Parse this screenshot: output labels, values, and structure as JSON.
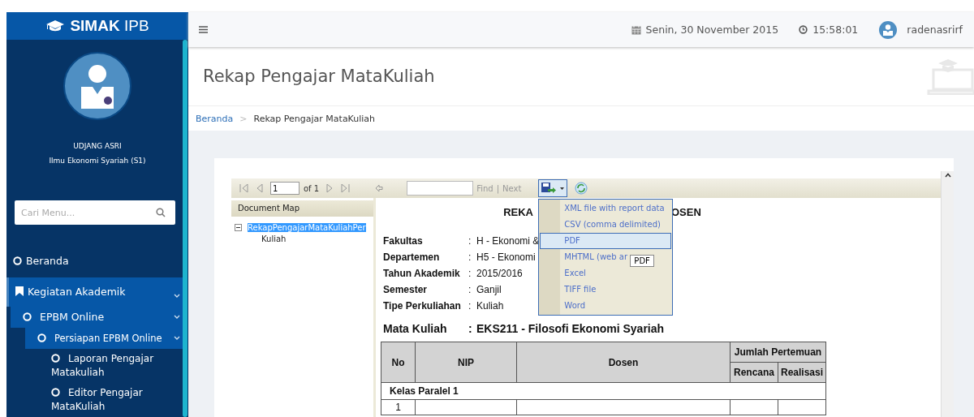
{
  "brand": {
    "bold": "SIMAK",
    "light": "IPB"
  },
  "topbar": {
    "date": "Senin, 30 November 2015",
    "time": "15:58:01",
    "username": "radenasrirf"
  },
  "profile": {
    "name": "UDJANG ASRI",
    "program": "Ilmu Ekonomi Syariah (S1)"
  },
  "search": {
    "placeholder": "Cari Menu..."
  },
  "menu": [
    {
      "label": "Beranda",
      "kind": "circle",
      "selected": false
    },
    {
      "label": "Kegiatan Akademik",
      "kind": "bookmark",
      "selected": true,
      "expanded": true,
      "children": [
        {
          "label": "EPBM Online",
          "kind": "circle",
          "selected": true,
          "expanded": true,
          "children": [
            {
              "label": "Persiapan EPBM Online",
              "kind": "circle",
              "selected": true,
              "expanded": true,
              "children": [
                {
                  "label": "Laporan Pengajar Matakuliah",
                  "kind": "circle",
                  "selected": false
                },
                {
                  "label": "Editor Pengajar MataKuliah",
                  "kind": "circle",
                  "selected": false
                }
              ]
            }
          ]
        }
      ]
    }
  ],
  "page_title": "Rekap Pengajar MataKuliah",
  "breadcrumb": {
    "separator": ">",
    "items": [
      {
        "label": "Beranda",
        "link": true
      },
      {
        "label": "Rekap Pengajar MataKuliah",
        "link": false
      }
    ]
  },
  "viewer": {
    "page": "1",
    "page_of": "of 1",
    "find": "Find",
    "find_sep": "|",
    "next": "Next",
    "export_menu": [
      {
        "label": "XML file with report data",
        "selected": false
      },
      {
        "label": "CSV (comma delimited)",
        "selected": false
      },
      {
        "label": "PDF",
        "selected": true
      },
      {
        "label": "MHTML (web ar",
        "selected": false
      },
      {
        "label": "Excel",
        "selected": false
      },
      {
        "label": "TIFF file",
        "selected": false
      },
      {
        "label": "Word",
        "selected": false
      }
    ],
    "tooltip": "PDF",
    "document_map": {
      "title": "Document Map",
      "items": [
        {
          "label": "RekapPengajarMataKuliahPer",
          "selected": true,
          "expanded": true,
          "children": [
            {
              "label": "Kuliah",
              "selected": false
            }
          ]
        }
      ]
    }
  },
  "report": {
    "title_left": "REKA",
    "title_right": "OSEN",
    "fields": [
      {
        "label": "Fakultas",
        "value": "H - Ekonomi &"
      },
      {
        "label": "Departemen",
        "value": "H5 - Ekonomi"
      },
      {
        "label": "Tahun Akademik",
        "value": "2015/2016"
      },
      {
        "label": "Semester",
        "value": "Ganjil"
      },
      {
        "label": "Tipe Perkuliahan",
        "value": "Kuliah"
      }
    ],
    "course": {
      "label": "Mata Kuliah",
      "value": "EKS211 - Filosofi Ekonomi Syariah"
    },
    "separator": ":",
    "table": {
      "columns": [
        "No",
        "NIP",
        "Dosen"
      ],
      "group_header": "Jumlah Pertemuan",
      "subcolumns": [
        "Rencana",
        "Realisasi"
      ],
      "groups": [
        {
          "title": "Kelas Paralel 1",
          "rows": [
            [
              "1",
              "",
              "",
              "",
              ""
            ]
          ]
        }
      ]
    }
  }
}
